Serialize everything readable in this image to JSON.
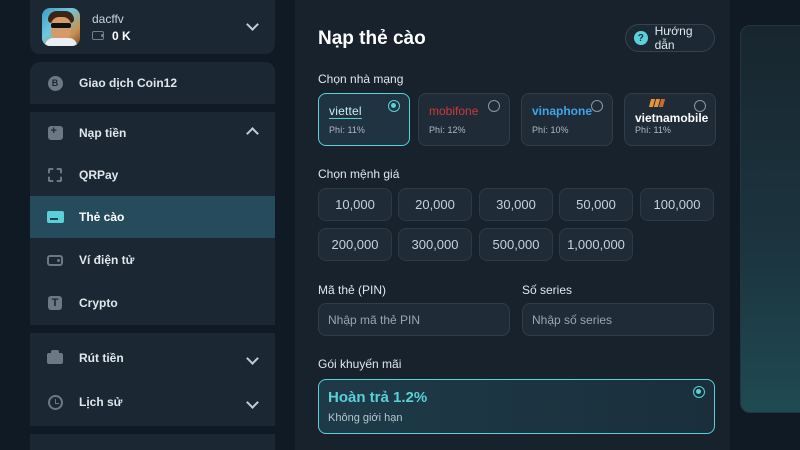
{
  "user": {
    "name": "dacffv",
    "balance": "0 K"
  },
  "sidebar": {
    "items": [
      {
        "label": "Giao dịch Coin12",
        "icon": "coin-icon"
      },
      {
        "label": "Nạp tiền",
        "icon": "deposit-icon"
      },
      {
        "label": "QRPay",
        "icon": "qr-icon"
      },
      {
        "label": "Thẻ cào",
        "icon": "card-icon"
      },
      {
        "label": "Ví điện tử",
        "icon": "wallet-icon"
      },
      {
        "label": "Crypto",
        "icon": "crypto-icon"
      },
      {
        "label": "Rút tiền",
        "icon": "withdraw-icon"
      },
      {
        "label": "Lịch sử",
        "icon": "history-icon"
      }
    ]
  },
  "main": {
    "title": "Nạp thẻ cào",
    "guide_label": "Hướng dẫn",
    "carrier_label": "Chọn nhà mạng",
    "carriers": [
      {
        "name": "viettel",
        "fee": "Phí: 11%",
        "selected": true
      },
      {
        "name": "mobifone",
        "fee": "Phí: 12%",
        "selected": false
      },
      {
        "name": "vinaphone",
        "fee": "Phí: 10%",
        "selected": false
      },
      {
        "name": "vietnamobile",
        "fee": "Phí: 11%",
        "selected": false
      }
    ],
    "denom_label": "Chọn mệnh giá",
    "denominations": [
      "10,000",
      "20,000",
      "30,000",
      "50,000",
      "100,000",
      "200,000",
      "300,000",
      "500,000",
      "1,000,000"
    ],
    "pin_label": "Mã thẻ (PIN)",
    "pin_placeholder": "Nhập mã thẻ PIN",
    "serial_label": "Số series",
    "serial_placeholder": "Nhập số series",
    "promo_label": "Gói khuyến mãi",
    "promo": {
      "title": "Hoàn trả 1.2%",
      "subtitle": "Không giới hạn",
      "selected": true
    }
  },
  "colors": {
    "accent": "#5ad0d8",
    "background": "#0f1a24",
    "panel": "#17222d",
    "active_nav": "#264b5c"
  }
}
